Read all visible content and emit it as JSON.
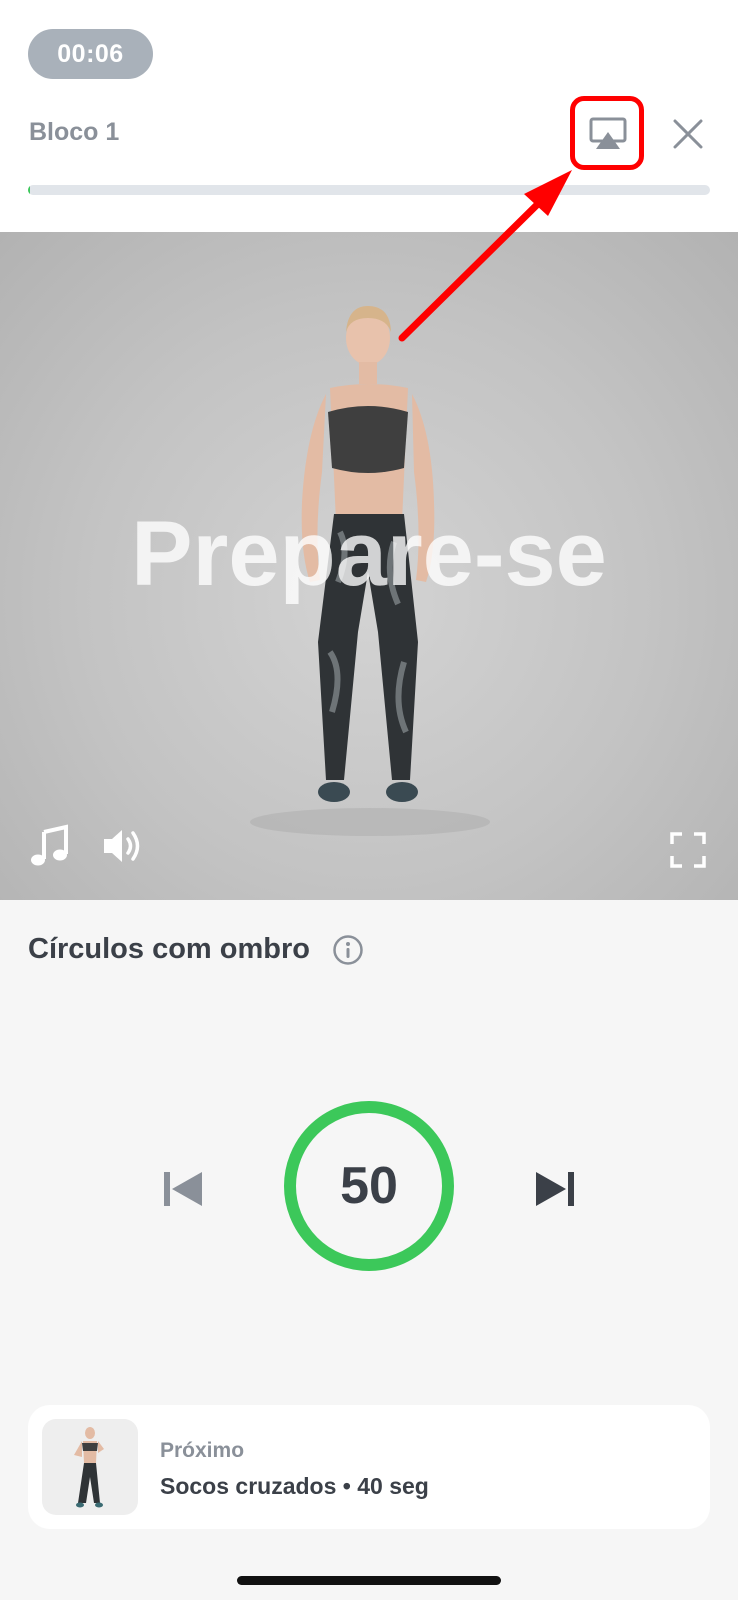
{
  "header": {
    "timer": "00:06",
    "block_title": "Bloco 1",
    "progress_fraction": 0.003
  },
  "video": {
    "overlay_text": "Prepare-se"
  },
  "exercise": {
    "name": "Círculos com ombro",
    "countdown": "50",
    "ring_color": "#3cc85a"
  },
  "next": {
    "label": "Próximo",
    "title": "Socos cruzados • 40 seg"
  },
  "icons": {
    "cast": "airplay-icon",
    "close": "close-icon",
    "music": "music-note-icon",
    "volume": "volume-icon",
    "fullscreen": "fullscreen-icon",
    "info": "info-icon",
    "previous": "skip-previous-icon",
    "next": "skip-next-icon"
  },
  "colors": {
    "accent_green": "#3cc85a",
    "annotation_red": "#ff0000"
  }
}
